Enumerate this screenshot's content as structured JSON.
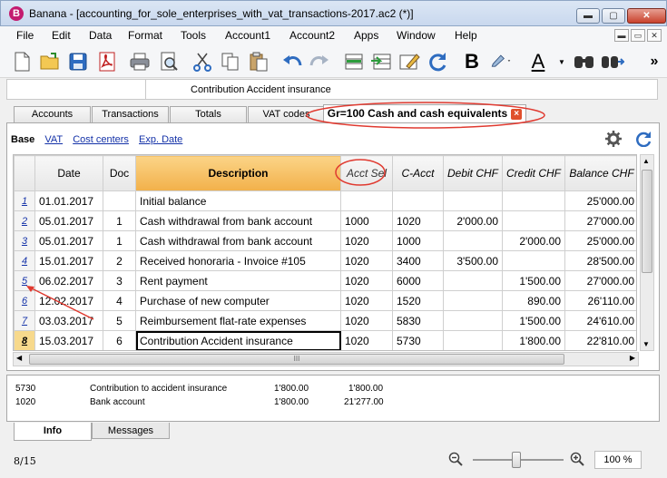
{
  "window": {
    "app_icon_letter": "B",
    "title": "Banana - [accounting_for_sole_enterprises_with_vat_transactions-2017.ac2 (*)]",
    "minimize": "▬",
    "maximize": "▢",
    "close": "✕"
  },
  "menu": [
    "File",
    "Edit",
    "Data",
    "Format",
    "Tools",
    "Account1",
    "Account2",
    "Apps",
    "Window",
    "Help"
  ],
  "mdi_controls": [
    "▬",
    "▭",
    "✕"
  ],
  "toolbar": {
    "icons": [
      "new-file-icon",
      "open-folder-icon",
      "save-icon",
      "pdf-icon",
      "print-icon",
      "print-preview-icon",
      "cut-icon",
      "copy-icon",
      "paste-icon",
      "undo-icon",
      "redo-icon",
      "add-rows-icon",
      "delete-rows-icon",
      "edit-icon",
      "recalculate-icon",
      "bold-icon",
      "highlight-color-icon",
      "text-color-icon",
      "find-icon",
      "find-next-icon"
    ],
    "bold_label": "B",
    "text_color_label": "A",
    "more_label": "»"
  },
  "cellbar": {
    "content": "Contribution Accident insurance"
  },
  "tabs": [
    {
      "label": "Accounts"
    },
    {
      "label": "Transactions"
    },
    {
      "label": "Totals"
    },
    {
      "label": "VAT codes"
    },
    {
      "label": "Gr=100 Cash and cash equivalents",
      "active": true
    }
  ],
  "tab_close": "×",
  "views": {
    "active": "Base",
    "links": [
      "VAT",
      "Cost centers",
      "Exp. Date"
    ]
  },
  "grid": {
    "columns": [
      "Date",
      "Doc",
      "Description",
      "Acct Sel",
      "C-Acct",
      "Debit CHF",
      "Credit CHF",
      "Balance CHF"
    ],
    "rows": [
      {
        "n": "1",
        "date": "01.01.2017",
        "doc": "",
        "desc": "Initial balance",
        "acct": "",
        "cacct": "",
        "debit": "",
        "credit": "",
        "balance": "25'000.00"
      },
      {
        "n": "2",
        "date": "05.01.2017",
        "doc": "1",
        "desc": "Cash withdrawal from bank account",
        "acct": "1000",
        "cacct": "1020",
        "debit": "2'000.00",
        "credit": "",
        "balance": "27'000.00"
      },
      {
        "n": "3",
        "date": "05.01.2017",
        "doc": "1",
        "desc": "Cash withdrawal from bank account",
        "acct": "1020",
        "cacct": "1000",
        "debit": "",
        "credit": "2'000.00",
        "balance": "25'000.00"
      },
      {
        "n": "4",
        "date": "15.01.2017",
        "doc": "2",
        "desc": "Received honoraria - Invoice #105",
        "acct": "1020",
        "cacct": "3400",
        "debit": "3'500.00",
        "credit": "",
        "balance": "28'500.00"
      },
      {
        "n": "5",
        "date": "06.02.2017",
        "doc": "3",
        "desc": "Rent payment",
        "acct": "1020",
        "cacct": "6000",
        "debit": "",
        "credit": "1'500.00",
        "balance": "27'000.00"
      },
      {
        "n": "6",
        "date": "12.02.2017",
        "doc": "4",
        "desc": "Purchase of new computer",
        "acct": "1020",
        "cacct": "1520",
        "debit": "",
        "credit": "890.00",
        "balance": "26'110.00"
      },
      {
        "n": "7",
        "date": "03.03.2017",
        "doc": "5",
        "desc": "Reimbursement flat-rate expenses",
        "acct": "1020",
        "cacct": "5830",
        "debit": "",
        "credit": "1'500.00",
        "balance": "24'610.00"
      },
      {
        "n": "8",
        "date": "15.03.2017",
        "doc": "6",
        "desc": "Contribution Accident insurance",
        "acct": "1020",
        "cacct": "5730",
        "debit": "",
        "credit": "1'800.00",
        "balance": "22'810.00",
        "current": true
      }
    ],
    "hscroll_grip": "III"
  },
  "info": [
    {
      "account": "5730",
      "description": "Contribution to accident insurance",
      "amount": "1'800.00",
      "balance": "1'800.00"
    },
    {
      "account": "1020",
      "description": "Bank account",
      "amount": "1'800.00",
      "balance": "21'277.00"
    }
  ],
  "bottom_tabs": [
    {
      "label": "Info",
      "active": true
    },
    {
      "label": "Messages"
    }
  ],
  "status": {
    "position": "8/15",
    "zoom": "100 %"
  },
  "colors": {
    "description_header": "#f2b04a",
    "annotation_red": "#e03a30",
    "link_blue": "#1432a8"
  }
}
